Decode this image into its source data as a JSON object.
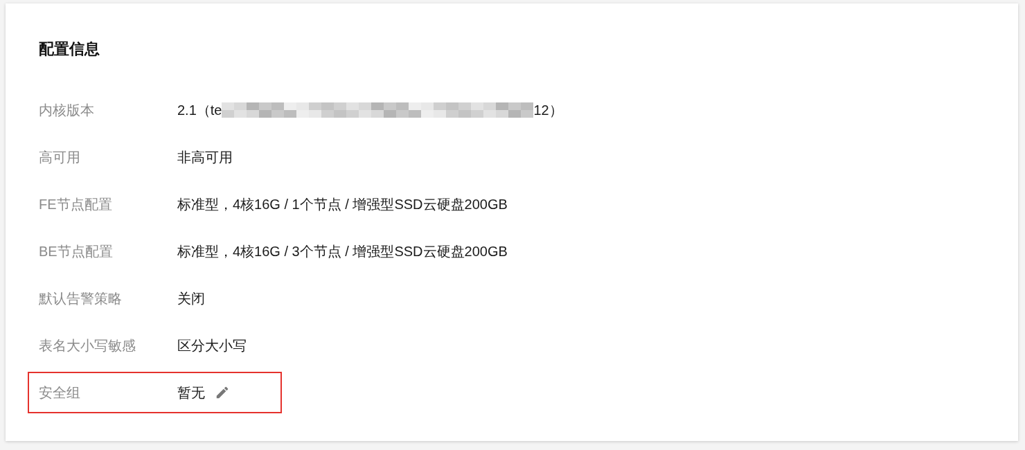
{
  "card": {
    "title": "配置信息",
    "rows": [
      {
        "kind": "redacted",
        "label": "内核版本",
        "value_start": "2.1（te",
        "value_end": "12）",
        "highlighted": false
      },
      {
        "kind": "text",
        "label": "高可用",
        "value": "非高可用",
        "highlighted": false
      },
      {
        "kind": "text",
        "label": "FE节点配置",
        "value": "标准型，4核16G / 1个节点 / 增强型SSD云硬盘200GB",
        "highlighted": false
      },
      {
        "kind": "text",
        "label": "BE节点配置",
        "value": "标准型，4核16G / 3个节点 / 增强型SSD云硬盘200GB",
        "highlighted": false
      },
      {
        "kind": "text",
        "label": "默认告警策略",
        "value": "关闭",
        "highlighted": false
      },
      {
        "kind": "text",
        "label": "表名大小写敏感",
        "value": "区分大小写",
        "highlighted": false
      },
      {
        "kind": "editable",
        "label": "安全组",
        "value": "暂无",
        "highlighted": true
      }
    ]
  }
}
